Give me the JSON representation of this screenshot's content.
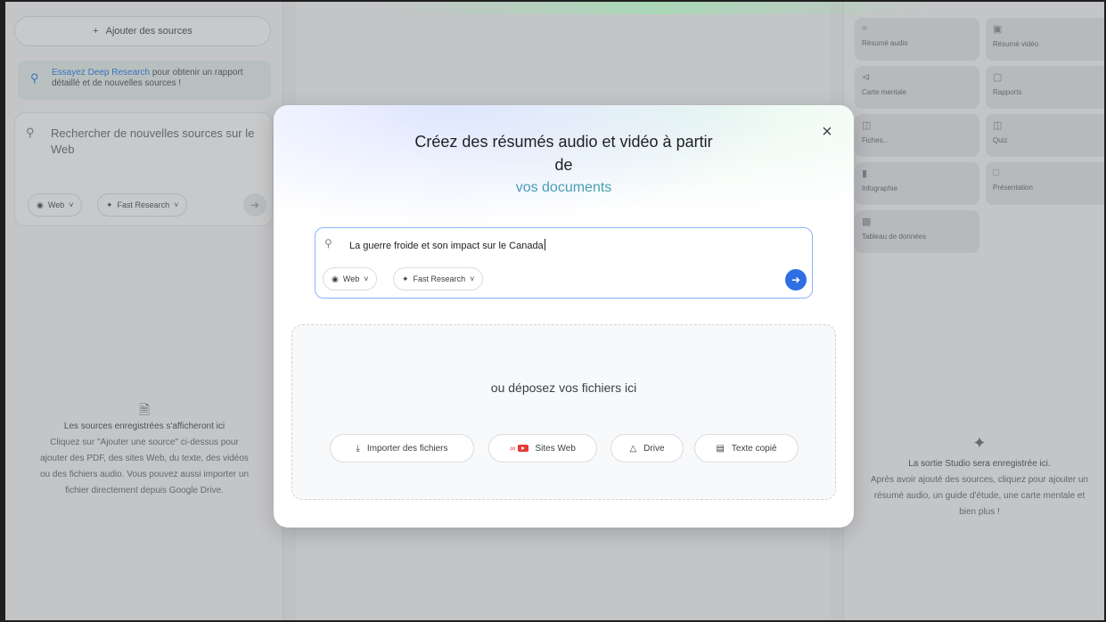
{
  "left_panel": {
    "add_sources_label": "Ajouter des sources",
    "deep_research": {
      "link": "Essayez Deep Research",
      "text": " pour obtenir un rapport détaillé et de nouvelles sources !"
    },
    "search_placeholder": "Rechercher de nouvelles sources sur le Web",
    "web_chip": "Web",
    "research_chip": "Fast Research",
    "empty_title": "Les sources enregistrées s'afficheront ici",
    "empty_line1": "Cliquez sur \"Ajouter une source\" ci-dessus pour",
    "empty_line2": "ajouter des PDF, des sites Web, du texte, des vidéos",
    "empty_line3": "ou des fichiers audio. Vous pouvez aussi importer un",
    "empty_line4": "fichier directement depuis Google Drive."
  },
  "studio_panel": {
    "tiles": [
      {
        "label": "Résumé audio",
        "icon": "waveform-icon"
      },
      {
        "label": "Résumé vidéo",
        "icon": "video-icon"
      },
      {
        "label": "Carte mentale",
        "icon": "mindmap-icon"
      },
      {
        "label": "Rapports",
        "icon": "report-icon"
      },
      {
        "label": "Fiches...",
        "icon": "flashcard-icon"
      },
      {
        "label": "Quiz",
        "icon": "quiz-icon"
      },
      {
        "label": "Infographie",
        "icon": "chart-icon"
      },
      {
        "label": "Présentation",
        "icon": "presentation-icon"
      },
      {
        "label": "Tableau de données",
        "icon": "table-icon"
      }
    ],
    "empty_title": "La sortie Studio sera enregistrée ici.",
    "empty_line1": "Après avoir ajouté des sources, cliquez pour ajouter un",
    "empty_line2": "résumé audio, un guide d'étude, une carte mentale et",
    "empty_line3": "bien plus !"
  },
  "modal": {
    "title_line1": "Créez des résumés audio et vidéo à partir",
    "title_line2": "de",
    "title_line3": "vos documents",
    "query_value": "La guerre froide et son impact sur le Canada",
    "web_chip": "Web",
    "research_chip": "Fast Research",
    "drop_text": "ou déposez vos fichiers ici",
    "buttons": {
      "import": "Importer des fichiers",
      "websites": "Sites Web",
      "drive": "Drive",
      "copied_text": "Texte copié"
    }
  },
  "colors": {
    "accent_blue": "#2f6fe4",
    "gradient_green": "#3fb87a",
    "query_border": "#8ab4f8"
  }
}
